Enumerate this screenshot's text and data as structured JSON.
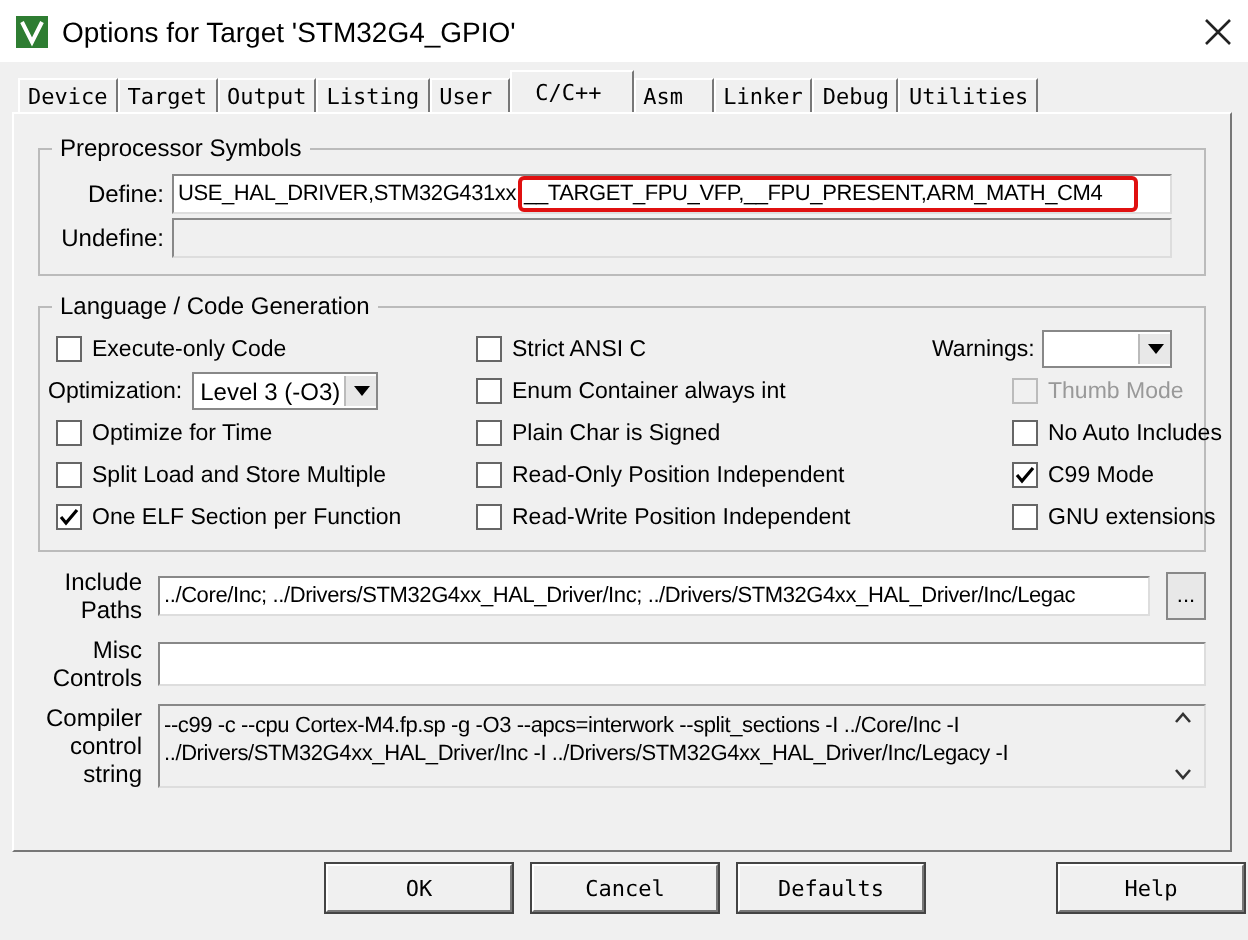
{
  "window": {
    "title": "Options for Target 'STM32G4_GPIO'"
  },
  "tabs": [
    {
      "label": "Device",
      "selected": false
    },
    {
      "label": "Target",
      "selected": false
    },
    {
      "label": "Output",
      "selected": false
    },
    {
      "label": "Listing",
      "selected": false
    },
    {
      "label": "User",
      "selected": false
    },
    {
      "label": "C/C++",
      "selected": true
    },
    {
      "label": "Asm",
      "selected": false
    },
    {
      "label": "Linker",
      "selected": false
    },
    {
      "label": "Debug",
      "selected": false
    },
    {
      "label": "Utilities",
      "selected": false
    }
  ],
  "preprocessor": {
    "title": "Preprocessor Symbols",
    "define_label": "Define:",
    "define_parts": [
      {
        "text": "USE_HAL_DRIVER,STM32G431xx",
        "highlighted": false
      },
      {
        "text": "__TARGET_FPU_VFP,__FPU_PRESENT,ARM_MATH_CM4",
        "highlighted": true
      }
    ],
    "undefine_label": "Undefine:",
    "undefine_disabled": true
  },
  "language": {
    "title": "Language / Code Generation",
    "columns": [
      [
        {
          "kind": "checkbox",
          "label": "Execute-only Code",
          "checked": false,
          "disabled": false
        },
        {
          "kind": "select",
          "label": "Optimization:",
          "value": "Level 3 (-O3)"
        },
        {
          "kind": "checkbox",
          "label": "Optimize for Time",
          "checked": false,
          "disabled": false
        },
        {
          "kind": "checkbox",
          "label": "Split Load and Store Multiple",
          "checked": false,
          "disabled": false
        },
        {
          "kind": "checkbox",
          "label": "One ELF Section per Function",
          "checked": true,
          "disabled": false
        }
      ],
      [
        {
          "kind": "checkbox",
          "label": "Strict ANSI C",
          "checked": false,
          "disabled": false
        },
        {
          "kind": "checkbox",
          "label": "Enum Container always int",
          "checked": false,
          "disabled": false
        },
        {
          "kind": "checkbox",
          "label": "Plain Char is Signed",
          "checked": false,
          "disabled": false
        },
        {
          "kind": "checkbox",
          "label": "Read-Only Position Independent",
          "checked": false,
          "disabled": false
        },
        {
          "kind": "checkbox",
          "label": "Read-Write Position Independent",
          "checked": false,
          "disabled": false
        }
      ],
      [
        {
          "kind": "select",
          "label": "Warnings:"
        },
        {
          "kind": "checkbox",
          "label": "Thumb Mode",
          "checked": false,
          "disabled": true
        },
        {
          "kind": "checkbox",
          "label": "No Auto Includes",
          "checked": false,
          "disabled": false
        },
        {
          "kind": "checkbox",
          "label": "C99 Mode",
          "checked": true,
          "disabled": false
        },
        {
          "kind": "checkbox",
          "label": "GNU extensions",
          "checked": false,
          "disabled": false
        }
      ]
    ]
  },
  "include_paths": {
    "label_lines": [
      "Include",
      "Paths"
    ],
    "value": "../Core/Inc; ../Drivers/STM32G4xx_HAL_Driver/Inc; ../Drivers/STM32G4xx_HAL_Driver/Inc/Legac",
    "browse": "..."
  },
  "misc_controls": {
    "label_lines": [
      "Misc",
      "Controls"
    ]
  },
  "compiler_string": {
    "label_lines": [
      "Compiler",
      "control",
      "string"
    ],
    "lines": [
      "--c99 -c --cpu Cortex-M4.fp.sp -g -O3 --apcs=interwork --split_sections -I ../Core/Inc -I",
      "../Drivers/STM32G4xx_HAL_Driver/Inc -I ../Drivers/STM32G4xx_HAL_Driver/Inc/Legacy -I"
    ]
  },
  "buttons": [
    "OK",
    "Cancel",
    "Defaults",
    "Help"
  ]
}
